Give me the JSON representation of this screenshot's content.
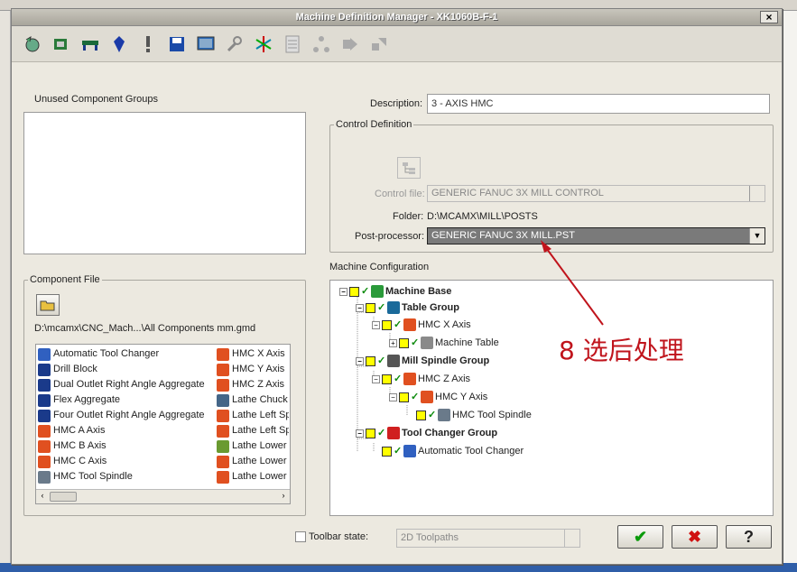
{
  "window": {
    "title": "Machine Definition Manager - XK1060B-F-1",
    "close": "×"
  },
  "toolbar": [
    {
      "name": "open-machine-icon"
    },
    {
      "name": "machine-base-icon"
    },
    {
      "name": "table-icon"
    },
    {
      "name": "spindle-icon"
    },
    {
      "name": "warning-icon"
    },
    {
      "name": "save-icon"
    },
    {
      "name": "screen-icon"
    },
    {
      "name": "wrench-icon"
    },
    {
      "name": "axes-icon"
    },
    {
      "name": "list-icon"
    },
    {
      "name": "tree-icon"
    },
    {
      "name": "arrow-right-icon"
    },
    {
      "name": "arrow-up-right-icon"
    }
  ],
  "unused": {
    "label": "Unused Component Groups"
  },
  "component_file": {
    "legend": "Component File",
    "path": "D:\\mcamx\\CNC_Mach...\\All Components mm.gmd",
    "col1": [
      "Automatic Tool Changer",
      "Drill Block",
      "Dual Outlet Right Angle Aggregate",
      "Flex Aggregate",
      "Four Outlet Right Angle Aggregate",
      "HMC A Axis",
      "HMC B Axis",
      "HMC C Axis",
      "HMC Tool Spindle"
    ],
    "col2": [
      "HMC X Axis",
      "HMC Y Axis",
      "HMC Z Axis",
      "Lathe Chuck",
      "Lathe Left Sp",
      "Lathe Left Sp",
      "Lathe Lower",
      "Lathe Lower",
      "Lathe Lower"
    ]
  },
  "description": {
    "label": "Description:",
    "value": "3 - AXIS HMC"
  },
  "control": {
    "legend": "Control Definition",
    "control_file_label": "Control file:",
    "control_file_value": "GENERIC FANUC 3X MILL CONTROL",
    "folder_label": "Folder:",
    "folder_value": "D:\\MCAMX\\MILL\\POSTS",
    "post_label": "Post-processor:",
    "post_value": "GENERIC FANUC 3X MILL.PST"
  },
  "machine_config": {
    "label": "Machine Configuration",
    "nodes": [
      {
        "text": "Machine Base",
        "bold": true
      },
      {
        "text": "Table Group",
        "bold": true
      },
      {
        "text": "HMC X Axis",
        "bold": false
      },
      {
        "text": "Machine Table",
        "bold": false
      },
      {
        "text": "Mill Spindle Group",
        "bold": true
      },
      {
        "text": "HMC Z Axis",
        "bold": false
      },
      {
        "text": "HMC Y Axis",
        "bold": false
      },
      {
        "text": "HMC Tool Spindle",
        "bold": false
      },
      {
        "text": "Tool Changer Group",
        "bold": true
      },
      {
        "text": "Automatic Tool Changer",
        "bold": false
      }
    ]
  },
  "toolbar_state": {
    "label": "Toolbar state:",
    "value": "2D Toolpaths"
  },
  "buttons": {
    "ok": "✔",
    "cancel": "✖",
    "help": "?"
  },
  "annotation": "8 选后处理",
  "colors": {
    "annotation": "#c0141c",
    "title_bar": "#a8a59b",
    "dialog_bg": "#ece9e0"
  }
}
